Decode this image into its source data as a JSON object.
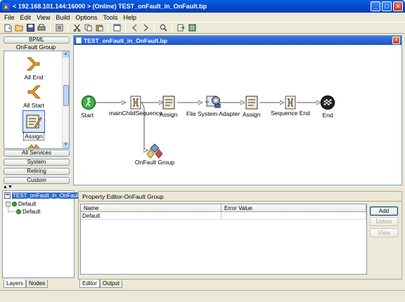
{
  "window": {
    "title": "< 192.168.101.144:16000 > (Online) TEST_onFault_in_OnFault.bp",
    "minimize": "_",
    "maximize": "□",
    "close": "✕"
  },
  "menu": [
    "File",
    "Edit",
    "View",
    "Build",
    "Options",
    "Tools",
    "Help"
  ],
  "toolbar_icons": [
    "new-icon",
    "open-icon",
    "save-icon",
    "print-icon",
    "preview-icon",
    "cut-icon",
    "copy-icon",
    "paste-icon",
    "window-icon",
    "back-icon",
    "forward-icon",
    "search-icon",
    "export-icon",
    "grid-icon"
  ],
  "palette": {
    "header": "BPML",
    "subheader": "OnFault Group",
    "items": [
      {
        "label": "All End",
        "icon": "all-end-icon"
      },
      {
        "label": "All Start",
        "icon": "all-start-icon"
      },
      {
        "label": "Assign",
        "icon": "assign-icon"
      }
    ],
    "groups": [
      "All Services",
      "System",
      "Retiring",
      "Custom"
    ]
  },
  "tree": {
    "root": "TEST_onFault_in_OnFault",
    "child": "Default",
    "grandchild": "Default",
    "expander": "−"
  },
  "left_tabs": [
    "Layers",
    "Nodes"
  ],
  "editor": {
    "title": "TEST_onFault_in_OnFault.bp",
    "close": "✕",
    "nodes": [
      "Start",
      "mainChildSequence",
      "Assign",
      "File System Adapter",
      "Assign",
      "Sequence End",
      "End",
      "OnFault Group"
    ]
  },
  "property_editor": {
    "title": "Property Editor-OnFault Group",
    "columns": [
      "Name",
      "Error Value"
    ],
    "rows": [
      [
        "Default",
        ""
      ]
    ],
    "buttons": {
      "add": "Add",
      "delete": "Delete",
      "view": "View"
    }
  },
  "bottom_tabs": [
    "Editor",
    "Output"
  ],
  "colors": {
    "title_bar": "#0a5fe6",
    "selection": "#316ac5",
    "panel": "#ece9d8"
  }
}
